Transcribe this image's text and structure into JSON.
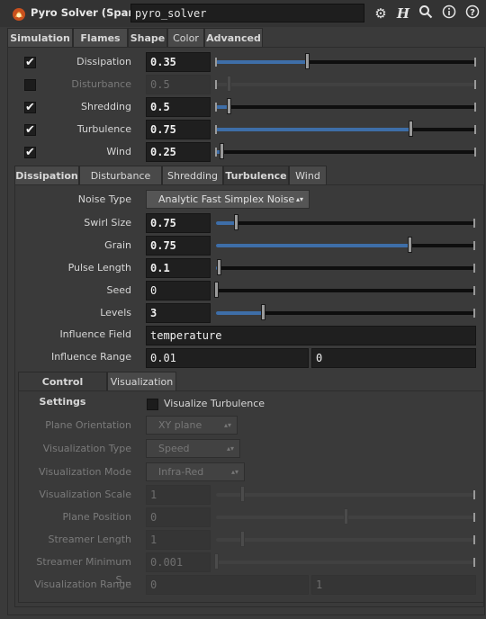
{
  "header": {
    "node_type": "Pyro Solver (Sparse)",
    "node_name": "pyro_solver",
    "icons": [
      "gear-icon",
      "help-h-icon",
      "search-icon",
      "info-icon",
      "question-icon"
    ]
  },
  "top_tabs": [
    "Simulation",
    "Flames",
    "Shape",
    "Color",
    "Advanced"
  ],
  "shape_params": [
    {
      "label": "Dissipation",
      "value": "0.35",
      "checked": true,
      "enabled": true,
      "fraction": 0.35
    },
    {
      "label": "Disturbance",
      "value": "0.5",
      "checked": false,
      "enabled": false,
      "fraction": 0.05
    },
    {
      "label": "Shredding",
      "value": "0.5",
      "checked": true,
      "enabled": true,
      "fraction": 0.05
    },
    {
      "label": "Turbulence",
      "value": "0.75",
      "checked": true,
      "enabled": true,
      "fraction": 0.75
    },
    {
      "label": "Wind",
      "value": "0.25",
      "checked": true,
      "enabled": true,
      "fraction": 0.02
    }
  ],
  "sub_tabs": [
    "Dissipation",
    "Disturbance",
    "Shredding",
    "Turbulence",
    "Wind"
  ],
  "turbulence": {
    "noise_type_label": "Noise Type",
    "noise_type": "Analytic Fast Simplex Noise",
    "rows": [
      {
        "label": "Swirl Size",
        "value": "0.75",
        "fraction": 0.075
      },
      {
        "label": "Grain",
        "value": "0.75",
        "fraction": 0.75
      },
      {
        "label": "Pulse Length",
        "value": "0.1",
        "fraction": 0.01
      },
      {
        "label": "Seed",
        "value": "0",
        "fraction": 0.0
      },
      {
        "label": "Levels",
        "value": "3",
        "fraction": 0.18
      }
    ],
    "influence_field_label": "Influence Field",
    "influence_field": "temperature",
    "influence_range_label": "Influence Range",
    "influence_range": [
      "0.01",
      "0"
    ]
  },
  "control_tabs": [
    "Control Settings",
    "Visualization"
  ],
  "control": {
    "visualize_label": "Visualize Turbulence",
    "menus": [
      {
        "label": "Plane Orientation",
        "value": "XY plane"
      },
      {
        "label": "Visualization Type",
        "value": "Speed"
      },
      {
        "label": "Visualization Mode",
        "value": "Infra-Red"
      }
    ],
    "sliders": [
      {
        "label": "Visualization Scale",
        "value": "1",
        "fraction": 0.1
      },
      {
        "label": "Plane Position",
        "value": "0",
        "fraction": 0.5
      },
      {
        "label": "Streamer Length",
        "value": "1",
        "fraction": 0.1
      },
      {
        "label": "Streamer Minimum S...",
        "value": "0.001",
        "fraction": 0.0
      }
    ],
    "range_label": "Visualization Range",
    "range": [
      "0",
      "1"
    ]
  }
}
